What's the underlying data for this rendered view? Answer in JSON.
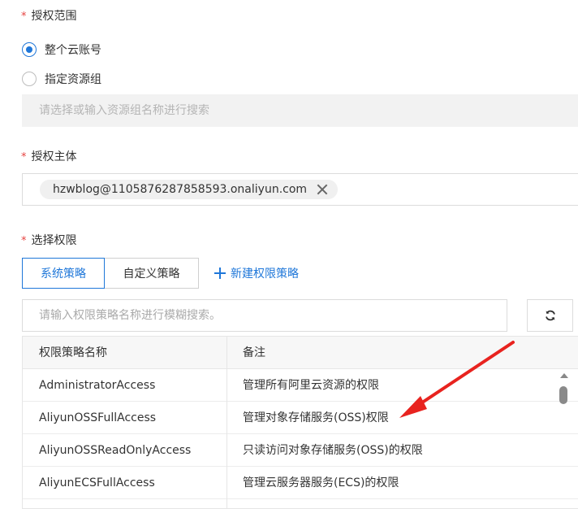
{
  "scope": {
    "required_mark": "*",
    "label": "授权范围",
    "options": [
      {
        "label": "整个云账号",
        "checked": true
      },
      {
        "label": "指定资源组",
        "checked": false
      }
    ],
    "resource_group_placeholder": "请选择或输入资源组名称进行搜索"
  },
  "principal": {
    "required_mark": "*",
    "label": "授权主体",
    "tag": "hzwblog@1105876287858593.onaliyun.com"
  },
  "permissions": {
    "required_mark": "*",
    "label": "选择权限",
    "tabs": [
      "系统策略",
      "自定义策略"
    ],
    "new_policy": "新建权限策略",
    "search_placeholder": "请输入权限策略名称进行模糊搜索。",
    "table": {
      "headers": [
        "权限策略名称",
        "备注"
      ],
      "rows": [
        {
          "name": "AdministratorAccess",
          "note": "管理所有阿里云资源的权限"
        },
        {
          "name": "AliyunOSSFullAccess",
          "note": "管理对象存储服务(OSS)权限"
        },
        {
          "name": "AliyunOSSReadOnlyAccess",
          "note": "只读访问对象存储服务(OSS)的权限"
        },
        {
          "name": "AliyunECSFullAccess",
          "note": "管理云服务器服务(ECS)的权限"
        }
      ]
    }
  },
  "colors": {
    "accent": "#1f77d9",
    "required": "#e64340",
    "annotation_arrow": "#e8231f"
  },
  "icons": {
    "refresh": "refresh-icon",
    "remove_tag": "close-icon",
    "add": "plus-icon"
  }
}
